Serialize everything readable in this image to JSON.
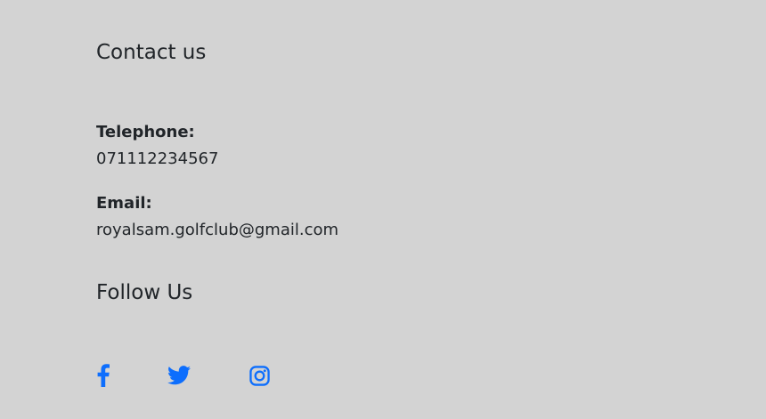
{
  "contact": {
    "heading": "Contact us",
    "telephone_label": "Telephone:",
    "telephone_value": "071112234567",
    "email_label": "Email:",
    "email_value": "royalsam.golfclub@gmail.com"
  },
  "follow": {
    "heading": "Follow Us",
    "icons": [
      "facebook-icon",
      "twitter-icon",
      "instagram-icon"
    ]
  },
  "colors": {
    "background": "#d3d3d3",
    "text": "#212529",
    "icon_accent": "#0d6efd"
  }
}
